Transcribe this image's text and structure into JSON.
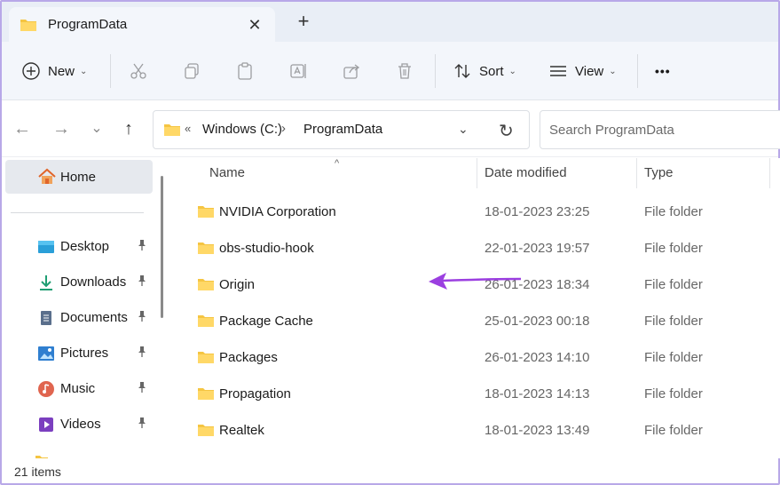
{
  "window": {
    "tab_title": "ProgramData",
    "close_glyph": "✕",
    "new_tab_glyph": "+"
  },
  "toolbar": {
    "new_label": "New",
    "sort_label": "Sort",
    "view_label": "View",
    "more_glyph": "•••",
    "caret": "⌄"
  },
  "address": {
    "chevron": "«",
    "drive": "Windows (C:)",
    "sep": "›",
    "folder": "ProgramData",
    "dropdown": "⌄",
    "refresh": "↻"
  },
  "search": {
    "placeholder": "Search ProgramData"
  },
  "nav": {
    "back": "←",
    "forward": "→",
    "recent": "⌄",
    "up": "↑"
  },
  "sidebar": {
    "home": "Home",
    "items": [
      {
        "label": "Desktop",
        "icon": "desktop-icon",
        "pin": "📌"
      },
      {
        "label": "Downloads",
        "icon": "download-icon",
        "pin": "📌"
      },
      {
        "label": "Documents",
        "icon": "documents-icon",
        "pin": "📌"
      },
      {
        "label": "Pictures",
        "icon": "pictures-icon",
        "pin": "📌"
      },
      {
        "label": "Music",
        "icon": "music-icon",
        "pin": "📌"
      },
      {
        "label": "Videos",
        "icon": "videos-icon",
        "pin": "📌"
      }
    ]
  },
  "columns": {
    "name": "Name",
    "date": "Date modified",
    "type": "Type",
    "sort_glyph": "^"
  },
  "files": [
    {
      "name": "NVIDIA Corporation",
      "date": "18-01-2023 23:25",
      "type": "File folder"
    },
    {
      "name": "obs-studio-hook",
      "date": "22-01-2023 19:57",
      "type": "File folder"
    },
    {
      "name": "Origin",
      "date": "26-01-2023 18:34",
      "type": "File folder"
    },
    {
      "name": "Package Cache",
      "date": "25-01-2023 00:18",
      "type": "File folder"
    },
    {
      "name": "Packages",
      "date": "26-01-2023 14:10",
      "type": "File folder"
    },
    {
      "name": "Propagation",
      "date": "18-01-2023 14:13",
      "type": "File folder"
    },
    {
      "name": "Realtek",
      "date": "18-01-2023 13:49",
      "type": "File folder"
    }
  ],
  "status": {
    "items_count": "21 items"
  },
  "colors": {
    "folder": "#f5c542",
    "accent_arrow": "#9b3fe0",
    "frame": "#b8a8e8"
  }
}
